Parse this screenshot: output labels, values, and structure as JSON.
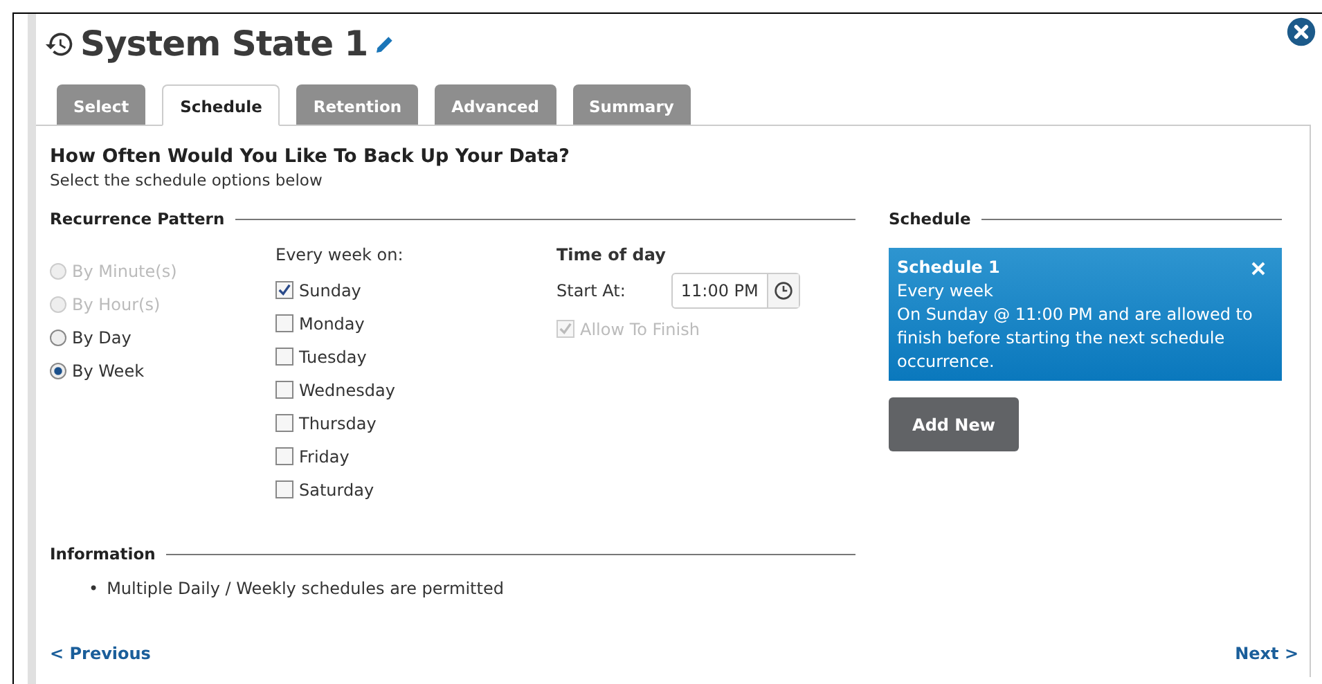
{
  "title": "System State 1",
  "tabs": [
    {
      "label": "Select",
      "selected": false
    },
    {
      "label": "Schedule",
      "selected": true
    },
    {
      "label": "Retention",
      "selected": false
    },
    {
      "label": "Advanced",
      "selected": false
    },
    {
      "label": "Summary",
      "selected": false
    }
  ],
  "heading": "How Often Would You Like To Back Up Your Data?",
  "subheading": "Select the schedule options below",
  "recurrence": {
    "title": "Recurrence Pattern",
    "options": [
      {
        "label": "By Minute(s)",
        "selected": false,
        "disabled": true
      },
      {
        "label": "By Hour(s)",
        "selected": false,
        "disabled": true
      },
      {
        "label": "By Day",
        "selected": false,
        "disabled": false
      },
      {
        "label": "By Week",
        "selected": true,
        "disabled": false
      }
    ],
    "days_label": "Every week on:",
    "days": [
      {
        "label": "Sunday",
        "checked": true
      },
      {
        "label": "Monday",
        "checked": false
      },
      {
        "label": "Tuesday",
        "checked": false
      },
      {
        "label": "Wednesday",
        "checked": false
      },
      {
        "label": "Thursday",
        "checked": false
      },
      {
        "label": "Friday",
        "checked": false
      },
      {
        "label": "Saturday",
        "checked": false
      }
    ],
    "time_title": "Time of day",
    "start_label": "Start At:",
    "start_value": "11:00 PM",
    "allow_finish": {
      "label": "Allow To Finish",
      "checked": true,
      "disabled": true
    }
  },
  "schedule": {
    "title": "Schedule",
    "cards": [
      {
        "title": "Schedule 1",
        "lines": [
          "Every week",
          "On Sunday @ 11:00 PM and are allowed to finish before starting the next schedule occurrence."
        ]
      }
    ],
    "add_button": "Add New"
  },
  "information": {
    "title": "Information",
    "bullet": "•",
    "items": [
      "Multiple Daily / Weekly schedules are permitted"
    ]
  },
  "nav": {
    "previous": "< Previous",
    "next": "Next >"
  }
}
